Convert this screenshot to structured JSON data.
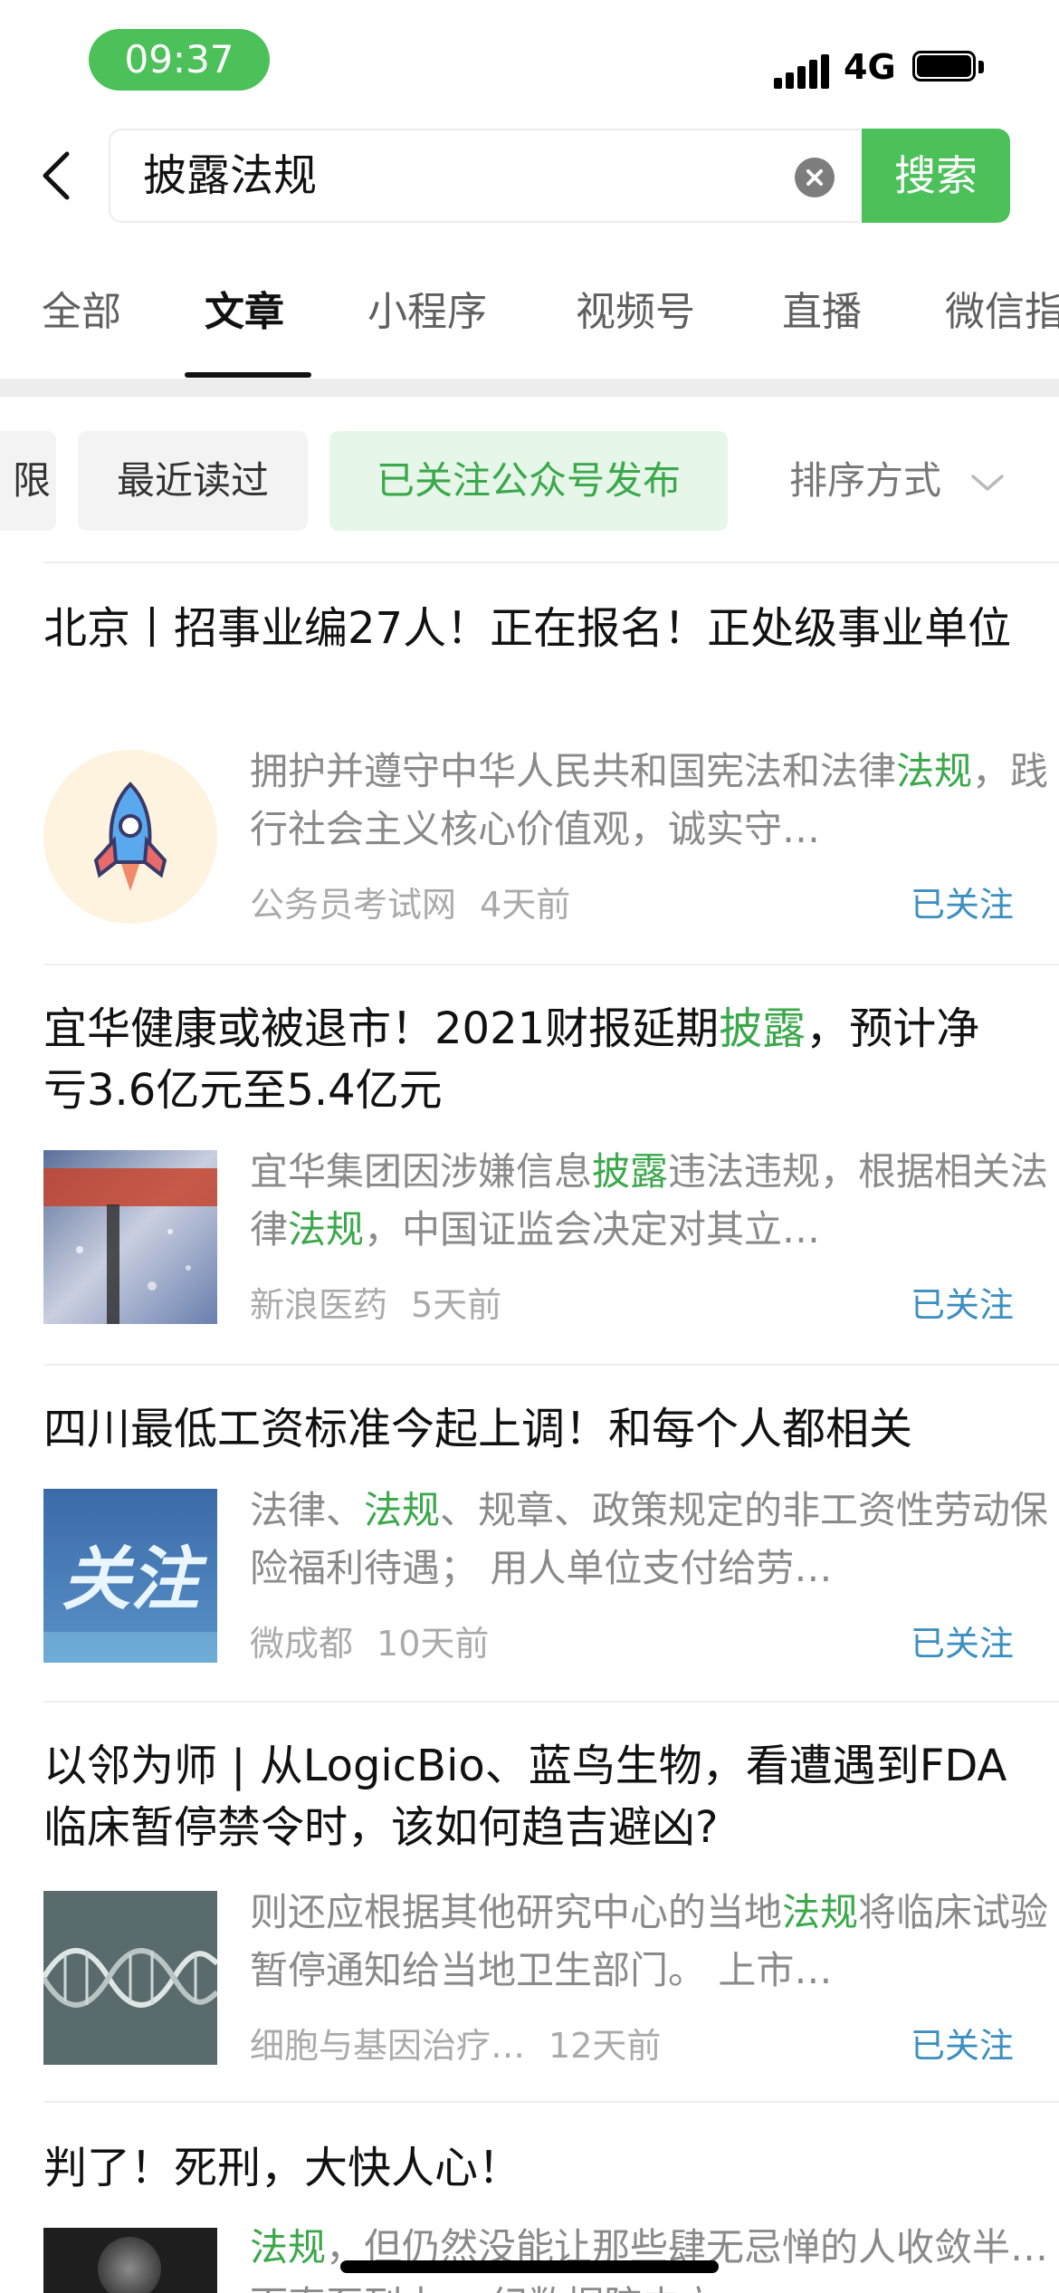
{
  "status_bar": {
    "time": "09:37",
    "network": "4G"
  },
  "search": {
    "query": "披露法规",
    "button_label": "搜索"
  },
  "tabs": [
    {
      "label": "全部"
    },
    {
      "label": "文章"
    },
    {
      "label": "小程序"
    },
    {
      "label": "视频号"
    },
    {
      "label": "直播"
    },
    {
      "label": "微信指"
    }
  ],
  "active_tab": "文章",
  "filters": {
    "clipped_chip": "限",
    "recent": "最近读过",
    "followed": "已关注公众号发布",
    "sort": "排序方式"
  },
  "articles": [
    {
      "title": "北京丨招事业编27人！正在报名！正处级事业单位",
      "snippet": [
        "拥护并遵守中华人民共和国宪法和法律",
        "法规",
        "，践行社会主义核心价值观，诚实守…"
      ],
      "source": "公务员考试网",
      "time": "4天前",
      "status": "已关注",
      "thumb": "rocket-icon"
    },
    {
      "title_parts": [
        "宜华健康或被退市！2021财报延期",
        "披露",
        "，预计净亏3.6亿元至5.4亿元"
      ],
      "snippet": [
        "宜华集团因涉嫌信息",
        "披露",
        "违法违规，根据相关法律",
        "法规",
        "，中国证监会决定对其立…"
      ],
      "source": "新浪医药",
      "time": "5天前",
      "status": "已关注",
      "thumb": "rain-window-photo"
    },
    {
      "title": "四川最低工资标准今起上调！和每个人都相关",
      "snippet": [
        "法律、",
        "法规",
        "、规章、政策规定的非工资性劳动保险福利待遇；  用人单位支付给劳…"
      ],
      "source": "微成都",
      "time": "10天前",
      "status": "已关注",
      "thumb": "关注"
    },
    {
      "title": "以邻为师 | 从LogicBio、蓝鸟生物，看遭遇到FDA临床暂停禁令时，该如何趋吉避凶?",
      "snippet": [
        "则还应根据其他研究中心的当地",
        "法规",
        "将临床试验暂停通知给当地卫生部门。  上市…"
      ],
      "source": "细胞与基因治疗…",
      "time": "12天前",
      "status": "已关注",
      "thumb": "dna-icon"
    },
    {
      "title": "判了！死刑，大快人心！",
      "snippet": [
        "法规",
        "，但仍然没能让那些肆无忌惮的人收敛半…  而直至列土，  纪数据院内立…"
      ],
      "thumb": "dark-photo"
    }
  ],
  "colors": {
    "accent_green": "#4cc15a",
    "highlight_green": "#3aa84b",
    "followed_blue": "#3c8fc0"
  }
}
